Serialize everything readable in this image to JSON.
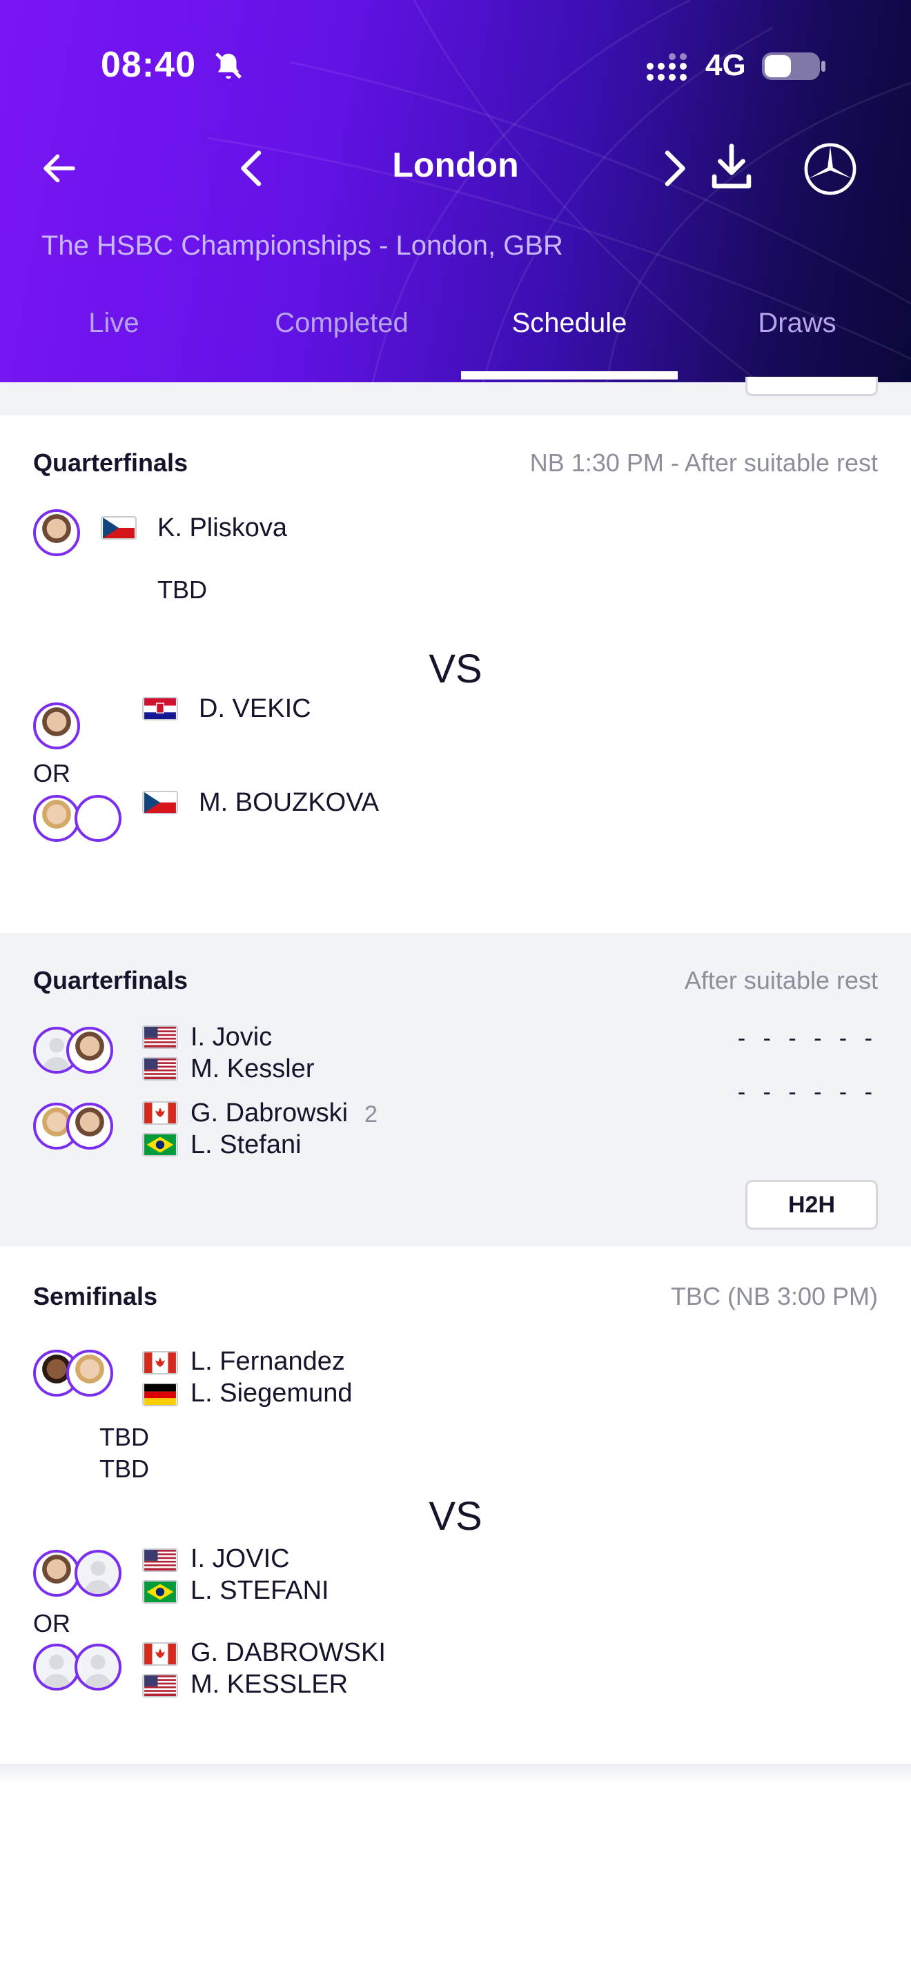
{
  "status_bar": {
    "time": "08:40",
    "network": "4G"
  },
  "nav": {
    "title": "London",
    "subtitle": "The HSBC Championships - London, GBR"
  },
  "tabs": [
    {
      "label": "Live",
      "active": false
    },
    {
      "label": "Completed",
      "active": false
    },
    {
      "label": "Schedule",
      "active": true
    },
    {
      "label": "Draws",
      "active": false
    }
  ],
  "matches": [
    {
      "round": "Quarterfinals",
      "time": "NB 1:30 PM - After suitable rest",
      "team1": {
        "name": "K. Pliskova",
        "flag": "CZE",
        "tbd": "TBD"
      },
      "vs": "VS",
      "team2_options": [
        {
          "name": "D. VEKIC",
          "flag": "CRO"
        },
        {
          "name": "M. BOUZKOVA",
          "flag": "CZE"
        }
      ],
      "or_label": "OR"
    },
    {
      "round": "Quarterfinals",
      "time": "After suitable rest",
      "team1": {
        "players": [
          {
            "name": "I. Jovic",
            "flag": "USA"
          },
          {
            "name": "M. Kessler",
            "flag": "USA"
          }
        ],
        "score": "- - - - - -"
      },
      "team2": {
        "players": [
          {
            "name": "G. Dabrowski",
            "flag": "CAN"
          },
          {
            "name": "L. Stefani",
            "flag": "BRA"
          }
        ],
        "seed": "2",
        "score": "- - - - - -"
      },
      "h2h_label": "H2H"
    },
    {
      "round": "Semifinals",
      "time": "TBC (NB 3:00 PM)",
      "team1": {
        "players": [
          {
            "name": "L. Fernandez",
            "flag": "CAN"
          },
          {
            "name": "L. Siegemund",
            "flag": "GER"
          }
        ],
        "tbd": [
          "TBD",
          "TBD"
        ]
      },
      "vs": "VS",
      "team2_options": [
        {
          "players": [
            {
              "name": "I. JOVIC",
              "flag": "USA"
            },
            {
              "name": "L. STEFANI",
              "flag": "BRA"
            }
          ]
        },
        {
          "players": [
            {
              "name": "G. DABROWSKI",
              "flag": "CAN"
            },
            {
              "name": "M. KESSLER",
              "flag": "USA"
            }
          ]
        }
      ],
      "or_label": "OR"
    }
  ],
  "colors": {
    "accent": "#7a2ff0",
    "header_start": "#7a16f3",
    "header_end": "#0a0838",
    "muted_text": "#8c8f9a"
  }
}
